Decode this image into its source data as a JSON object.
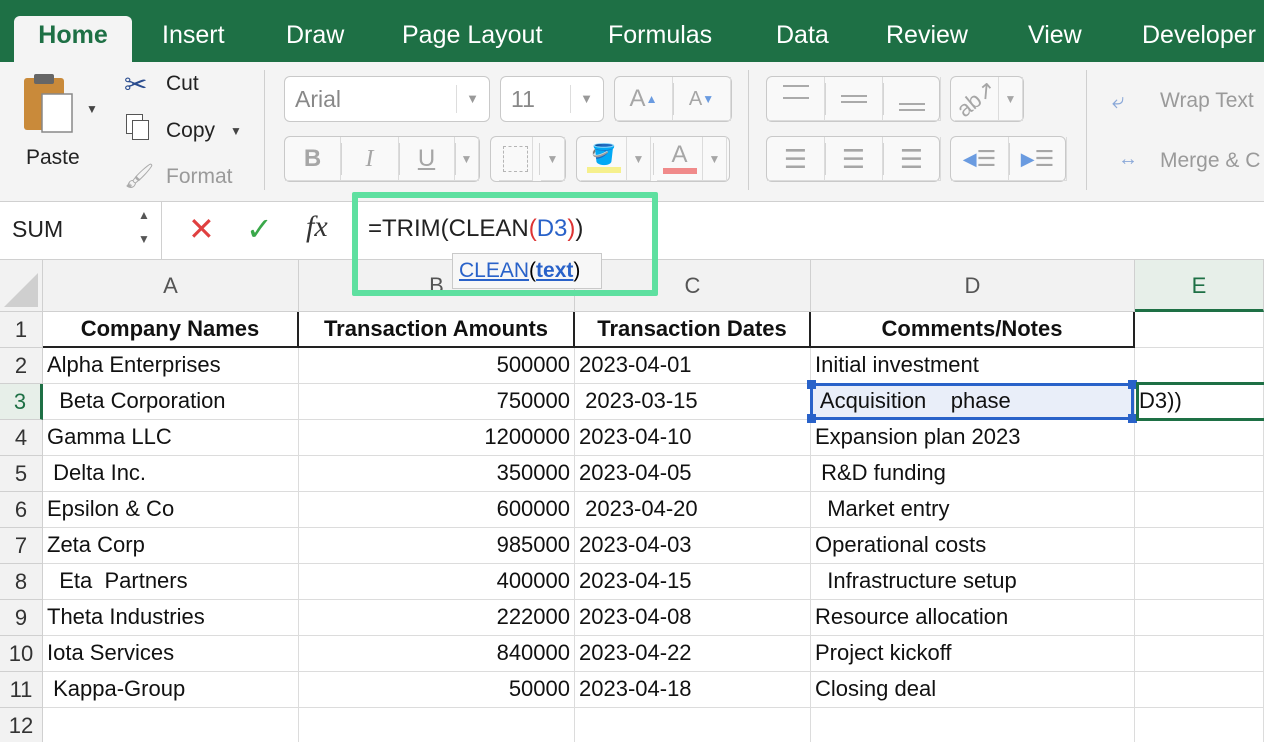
{
  "tabs": [
    {
      "label": "Home",
      "active": true
    },
    {
      "label": "Insert"
    },
    {
      "label": "Draw"
    },
    {
      "label": "Page Layout"
    },
    {
      "label": "Formulas"
    },
    {
      "label": "Data"
    },
    {
      "label": "Review"
    },
    {
      "label": "View"
    },
    {
      "label": "Developer"
    }
  ],
  "clipboard": {
    "paste": "Paste",
    "cut": "Cut",
    "copy": "Copy",
    "format": "Format"
  },
  "font": {
    "name": "Arial",
    "size": "11",
    "bold": "B",
    "italic": "I",
    "underline": "U",
    "grow": "A",
    "shrink": "A",
    "font_color": "A"
  },
  "alignment": {
    "wrap_text": "Wrap Text",
    "merge": "Merge & C"
  },
  "formula_bar": {
    "name_box": "SUM",
    "cancel": "✕",
    "enter": "✓",
    "fx": "fx",
    "formula_pre": "=TRIM(CLEAN",
    "formula_paren": "(",
    "formula_ref": "D3",
    "formula_paren2": ")",
    "formula_post": ")"
  },
  "tooltip": {
    "function": "CLEAN",
    "open": "(",
    "arg": "text",
    "close": ")"
  },
  "columns": [
    "A",
    "B",
    "C",
    "D",
    "E"
  ],
  "rows": [
    {
      "num": "1",
      "a": "Company Names",
      "b": "Transaction Amounts",
      "c": "Transaction Dates",
      "d": "Comments/Notes",
      "e": ""
    },
    {
      "num": "2",
      "a": "Alpha Enterprises",
      "b": "500000",
      "c": "2023-04-01",
      "d": "Initial investment",
      "e": ""
    },
    {
      "num": "3",
      "a": "  Beta Corporation",
      "b": "750000",
      "c": " 2023-03-15",
      "d": " Acquisition    phase",
      "e": "D3))"
    },
    {
      "num": "4",
      "a": "Gamma LLC",
      "b": "1200000",
      "c": "2023-04-10",
      "d": "Expansion plan 2023",
      "e": ""
    },
    {
      "num": "5",
      "a": " Delta Inc.",
      "b": "350000",
      "c": "2023-04-05",
      "d": " R&D funding",
      "e": ""
    },
    {
      "num": "6",
      "a": "Epsilon & Co",
      "b": "600000",
      "c": " 2023-04-20",
      "d": "  Market entry",
      "e": ""
    },
    {
      "num": "7",
      "a": "Zeta Corp",
      "b": "985000",
      "c": "2023-04-03",
      "d": "Operational costs",
      "e": ""
    },
    {
      "num": "8",
      "a": "  Eta  Partners",
      "b": "400000",
      "c": "2023-04-15",
      "d": "  Infrastructure setup",
      "e": ""
    },
    {
      "num": "9",
      "a": "Theta Industries",
      "b": "222000",
      "c": "2023-04-08",
      "d": "Resource allocation",
      "e": ""
    },
    {
      "num": "10",
      "a": "Iota Services",
      "b": "840000",
      "c": "2023-04-22",
      "d": "Project kickoff",
      "e": ""
    },
    {
      "num": "11",
      "a": " Kappa-Group",
      "b": "50000",
      "c": "2023-04-18",
      "d": "Closing deal",
      "e": ""
    },
    {
      "num": "12",
      "a": "",
      "b": "",
      "c": "",
      "d": "",
      "e": ""
    }
  ],
  "colors": {
    "accent": "#1e7045",
    "highlight": "#5ee0a0",
    "selection": "#2962c9"
  }
}
